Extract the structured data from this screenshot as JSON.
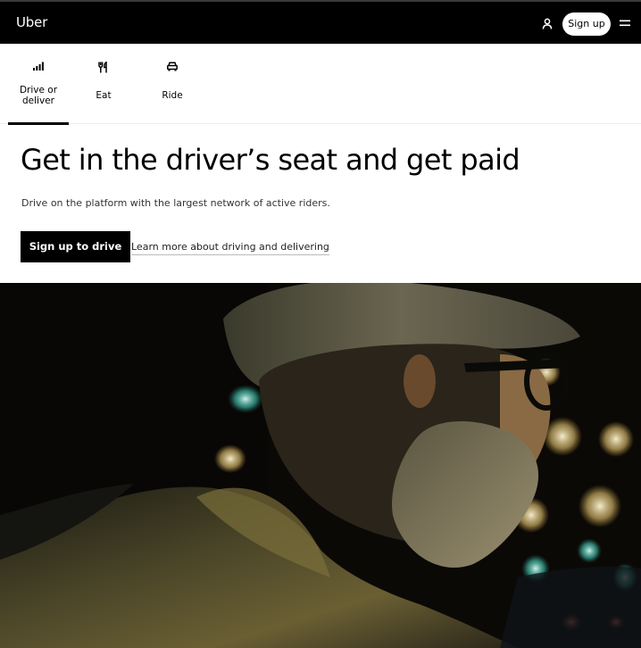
{
  "header": {
    "logo": "Uber",
    "signup_label": "Sign up",
    "icons": [
      "user-icon",
      "hamburger-menu-icon"
    ]
  },
  "tabs": [
    {
      "label": "Drive or deliver",
      "icon": "signal-bars-icon",
      "selected": true
    },
    {
      "label": "Eat",
      "icon": "fork-knife-icon",
      "selected": false
    },
    {
      "label": "Ride",
      "icon": "car-icon",
      "selected": false
    }
  ],
  "hero": {
    "headline": "Get in the driver’s seat and get paid",
    "subtext": "Drive on the platform with the largest network of active riders.",
    "cta_label": "Sign up to drive",
    "link_label": "Learn more about driving and delivering"
  },
  "colors": {
    "header_bg": "#000000",
    "accent": "#000000",
    "page_bg": "#ffffff"
  }
}
